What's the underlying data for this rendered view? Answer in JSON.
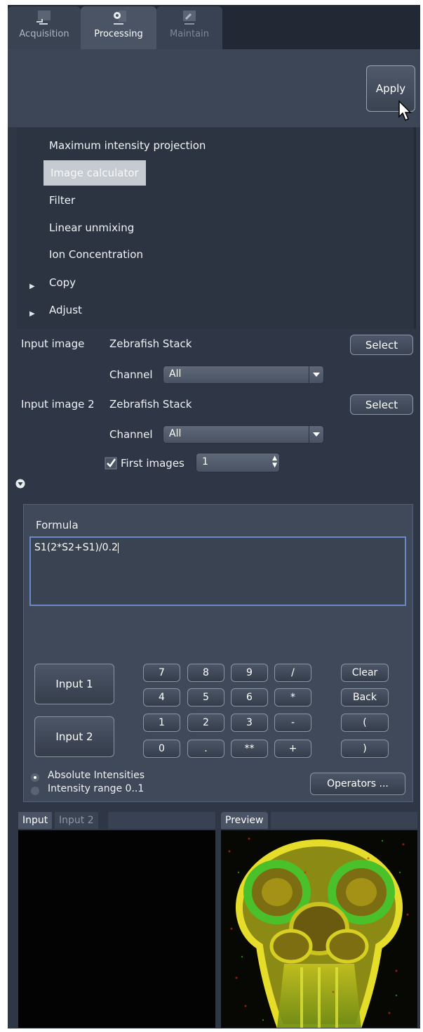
{
  "tabs": [
    {
      "label": "Acquisition"
    },
    {
      "label": "Processing"
    },
    {
      "label": "Maintain"
    }
  ],
  "apply_label": "Apply",
  "methods": [
    "Maximum intensity projection",
    "Image calculator",
    "Filter",
    "Linear unmixing",
    "Ion Concentration",
    "Copy",
    "Adjust"
  ],
  "input1": {
    "label": "Input image",
    "name": "Zebrafish Stack",
    "select": "Select",
    "channel_label": "Channel",
    "channel_value": "All"
  },
  "input2": {
    "label": "Input image 2",
    "name": "Zebrafish Stack",
    "select": "Select",
    "channel_label": "Channel",
    "channel_value": "All"
  },
  "first_images": {
    "label": "First images",
    "value": "1",
    "checked": true
  },
  "formula": {
    "label": "Formula",
    "value": "S1(2*S2+S1)/0.2"
  },
  "keypad": {
    "input1": "Input 1",
    "input2": "Input 2",
    "keys": [
      "7",
      "8",
      "9",
      "/",
      "4",
      "5",
      "6",
      "*",
      "1",
      "2",
      "3",
      "-",
      "0",
      ".",
      "**",
      "+"
    ],
    "side": [
      "Clear",
      "Back",
      "(",
      ")"
    ]
  },
  "radios": {
    "absolute": "Absolute Intensities",
    "range": "Intensity range 0..1"
  },
  "operators_label": "Operators ...",
  "view_tabs": {
    "input": "Input",
    "input2": "Input 2",
    "preview": "Preview"
  },
  "colors": {
    "panel": "#2f3746",
    "selected": "#c6cad1",
    "formula_border": "#6b89c8"
  }
}
